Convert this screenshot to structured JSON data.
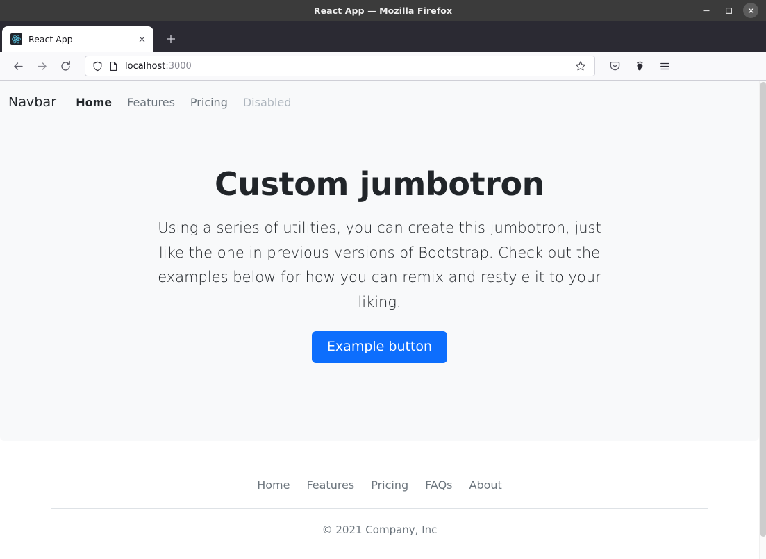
{
  "window": {
    "title": "React App — Mozilla Firefox",
    "minimize_label": "−",
    "maximize_label": "□",
    "close_label": "✕"
  },
  "browser": {
    "tab": {
      "title": "React App",
      "favicon": "react-logo-favicon",
      "close_label": "✕"
    },
    "new_tab_label": "+",
    "back_icon": "back-arrow-icon",
    "forward_icon": "forward-arrow-icon",
    "reload_icon": "reload-icon",
    "urlbar": {
      "shield_icon": "shield-icon",
      "page_icon": "page-document-icon",
      "host": "localhost",
      "port": ":3000",
      "bookmark_icon": "star-icon"
    },
    "toolbar_right": {
      "pocket_icon": "pocket-save-icon",
      "account_icon": "firefox-account-icon",
      "menu_icon": "hamburger-menu-icon"
    }
  },
  "site": {
    "navbar": {
      "brand": "Navbar",
      "links": [
        {
          "label": "Home",
          "state": "active"
        },
        {
          "label": "Features",
          "state": "default"
        },
        {
          "label": "Pricing",
          "state": "default"
        },
        {
          "label": "Disabled",
          "state": "disabled"
        }
      ]
    },
    "jumbotron": {
      "title": "Custom jumbotron",
      "text": "Using a series of utilities, you can create this jumbotron, just like the one in previous versions of Bootstrap. Check out the examples below for how you can remix and restyle it to your liking.",
      "button_label": "Example button",
      "button_color": "#0d6efd",
      "background_color": "#f8f9fa"
    },
    "footer": {
      "links": [
        "Home",
        "Features",
        "Pricing",
        "FAQs",
        "About"
      ],
      "copyright": "© 2021 Company, Inc"
    }
  }
}
